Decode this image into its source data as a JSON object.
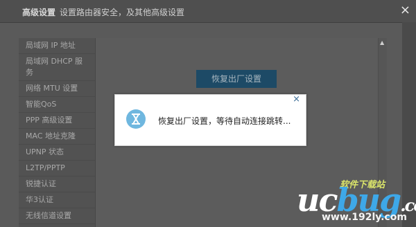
{
  "title": {
    "main": "高级设置",
    "subtitle": "设置路由器安全，及其他高级设置"
  },
  "sidebar": {
    "items": [
      {
        "label": "局域网 IP 地址"
      },
      {
        "label": "局域网 DHCP 服务"
      },
      {
        "label": "网络 MTU 设置"
      },
      {
        "label": "智能QoS"
      },
      {
        "label": "PPP 高级设置"
      },
      {
        "label": "MAC 地址克隆"
      },
      {
        "label": "UPNP 状态"
      },
      {
        "label": "L2TP/PPTP"
      },
      {
        "label": "锐捷认证"
      },
      {
        "label": "华3认证"
      },
      {
        "label": "无线信道设置"
      }
    ]
  },
  "content": {
    "restore_button": "恢复出厂设置"
  },
  "dialog": {
    "message": "恢复出厂设置，等待自动连接跳转...",
    "close": "×"
  },
  "watermark": {
    "top_text": "软件下载站",
    "logo_a": "uc",
    "logo_b": "bug",
    "logo_c": ".cc",
    "url": "www.192ly.com"
  },
  "icons": {
    "close": "close-icon",
    "dialog_icon": "hourglass-icon"
  }
}
